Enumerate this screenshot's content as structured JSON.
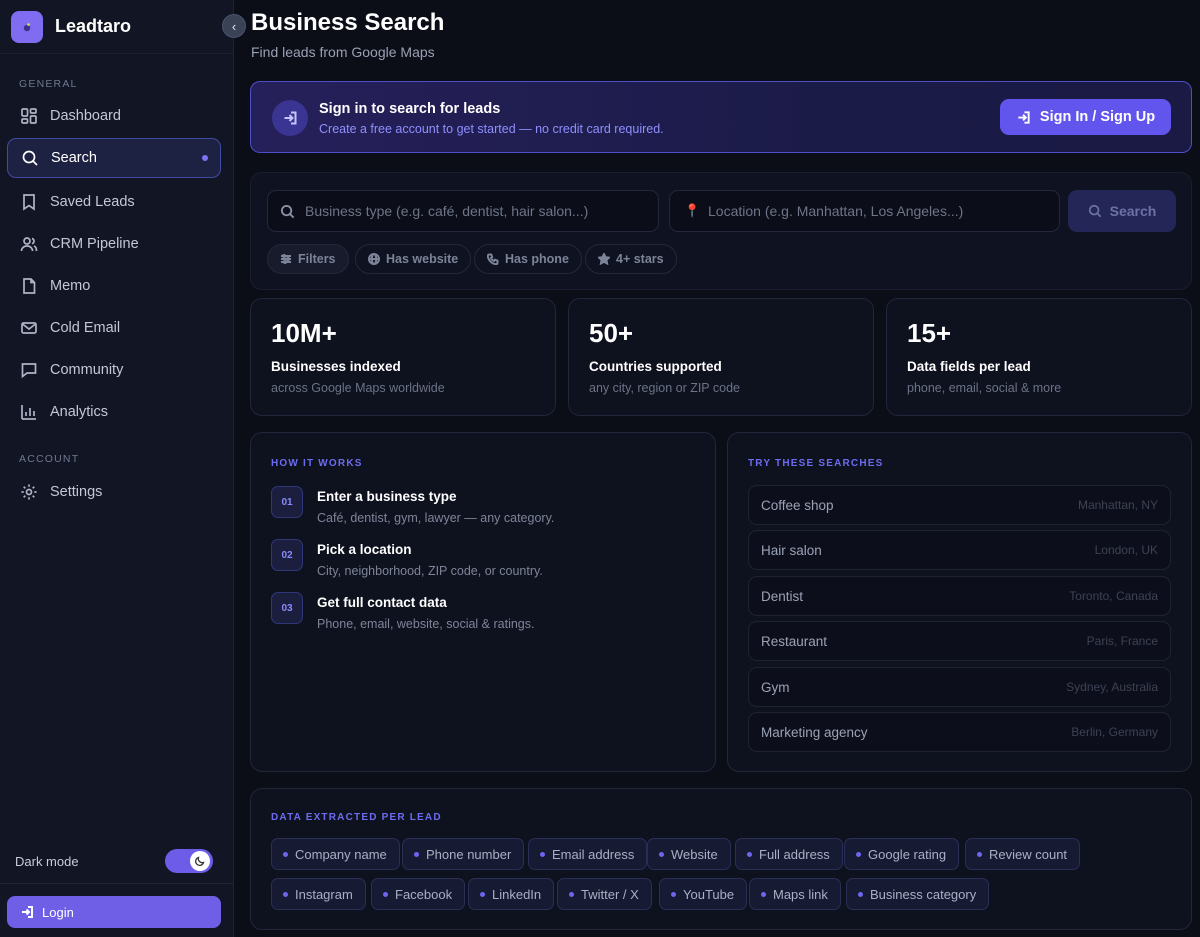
{
  "app": {
    "name": "Leadtaro"
  },
  "sidebar": {
    "general_label": "GENERAL",
    "account_label": "ACCOUNT",
    "items": [
      {
        "label": "Dashboard",
        "icon": "dashboard-icon"
      },
      {
        "label": "Search",
        "icon": "search-icon",
        "active": true
      },
      {
        "label": "Saved Leads",
        "icon": "bookmark-icon"
      },
      {
        "label": "CRM Pipeline",
        "icon": "users-icon"
      },
      {
        "label": "Memo",
        "icon": "document-icon"
      },
      {
        "label": "Cold Email",
        "icon": "mail-icon"
      },
      {
        "label": "Community",
        "icon": "chat-icon"
      },
      {
        "label": "Analytics",
        "icon": "bar-chart-icon"
      }
    ],
    "account_items": [
      {
        "label": "Settings",
        "icon": "gear-icon"
      }
    ],
    "dark_mode_label": "Dark mode",
    "dark_mode_on": true,
    "login_label": "Login"
  },
  "header": {
    "title": "Business Search",
    "subtitle": "Find leads from Google Maps"
  },
  "banner": {
    "title": "Sign in to search for leads",
    "subtitle": "Create a free account to get started — no credit card required.",
    "button_label": "Sign In / Sign Up"
  },
  "search": {
    "business_placeholder": "Business type (e.g. café, dentist, hair salon...)",
    "location_placeholder": "Location (e.g. Manhattan, Los Angeles...)",
    "button_label": "Search",
    "chips": [
      "Filters",
      "Has website",
      "Has phone",
      "4+ stars"
    ]
  },
  "stats": [
    {
      "value": "10M+",
      "label": "Businesses indexed",
      "sub": "across Google Maps worldwide"
    },
    {
      "value": "50+",
      "label": "Countries supported",
      "sub": "any city, region or ZIP code"
    },
    {
      "value": "15+",
      "label": "Data fields per lead",
      "sub": "phone, email, social & more"
    }
  ],
  "how_it_works": {
    "label": "HOW IT WORKS",
    "steps": [
      {
        "num": "01",
        "title": "Enter a business type",
        "sub": "Café, dentist, gym, lawyer — any category."
      },
      {
        "num": "02",
        "title": "Pick a location",
        "sub": "City, neighborhood, ZIP code, or country."
      },
      {
        "num": "03",
        "title": "Get full contact data",
        "sub": "Phone, email, website, social & ratings."
      }
    ]
  },
  "try_searches": {
    "label": "TRY THESE SEARCHES",
    "items": [
      {
        "query": "Coffee shop",
        "location": "Manhattan, NY"
      },
      {
        "query": "Hair salon",
        "location": "London, UK"
      },
      {
        "query": "Dentist",
        "location": "Toronto, Canada"
      },
      {
        "query": "Restaurant",
        "location": "Paris, France"
      },
      {
        "query": "Gym",
        "location": "Sydney, Australia"
      },
      {
        "query": "Marketing agency",
        "location": "Berlin, Germany"
      }
    ]
  },
  "data_extracted": {
    "label": "DATA EXTRACTED PER LEAD",
    "fields": [
      "Company name",
      "Phone number",
      "Email address",
      "Website",
      "Full address",
      "Google rating",
      "Review count",
      "Instagram",
      "Facebook",
      "LinkedIn",
      "Twitter / X",
      "YouTube",
      "Maps link",
      "Business category"
    ]
  },
  "colors": {
    "accent": "#6155ee",
    "background": "#0b0d17",
    "sidebar": "#111524",
    "active_dot": "#7d73f5"
  }
}
